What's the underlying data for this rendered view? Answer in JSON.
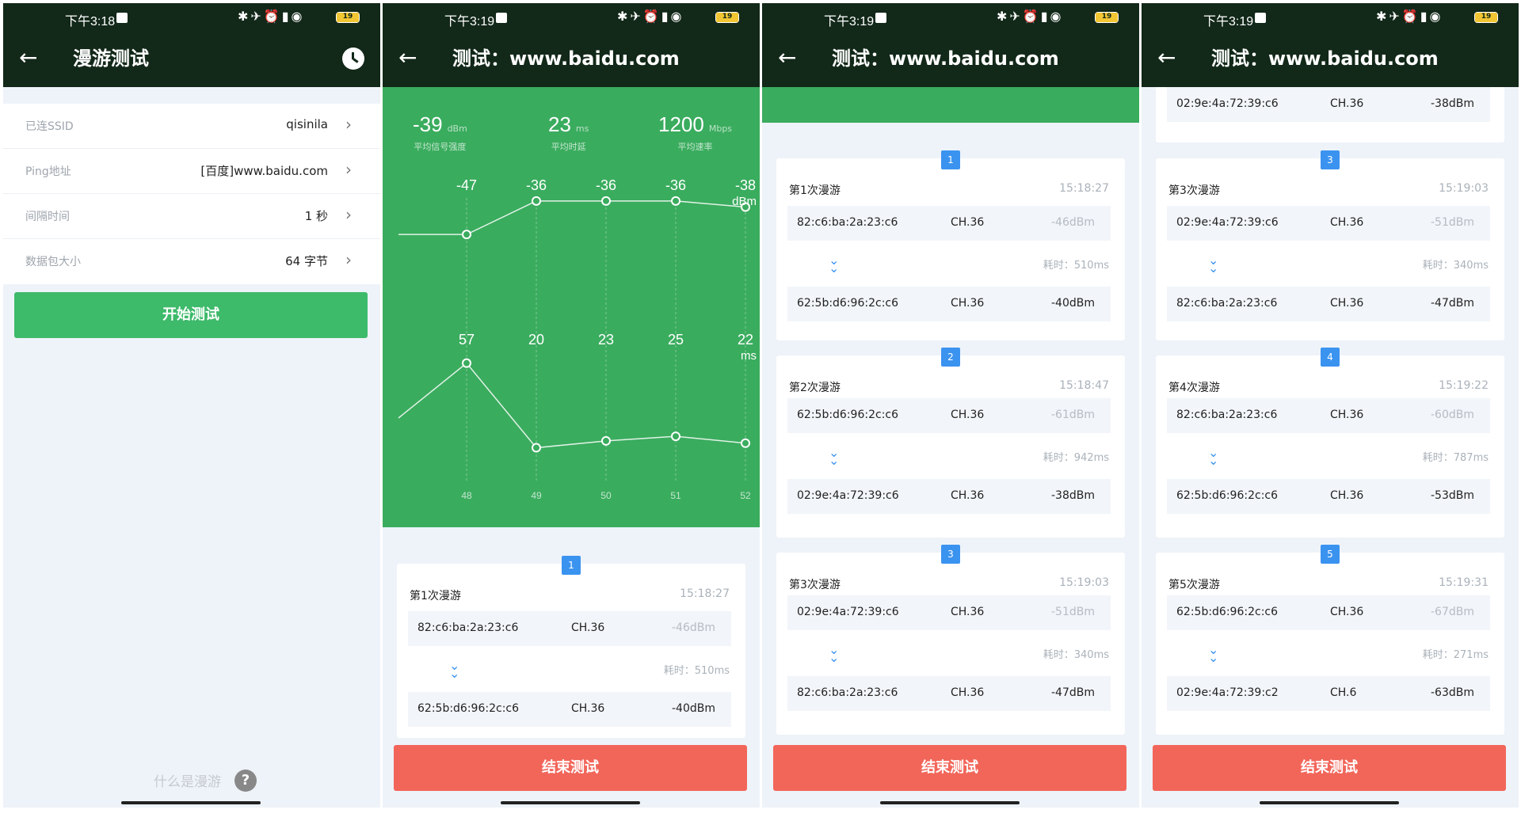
{
  "colors": {
    "appbar": "#122819",
    "green": "#3aac5e",
    "start_button": "#3dba6a",
    "end_button": "#f2665a",
    "badge": "#3b93f0"
  },
  "panel1": {
    "status_time": "下午3:18",
    "title": "漫游测试",
    "settings": [
      {
        "label": "已连SSID",
        "value": "qisinila"
      },
      {
        "label": "Ping地址",
        "value": "[百度]www.baidu.com"
      },
      {
        "label": "间隔时间",
        "value": "1 秒"
      },
      {
        "label": "数据包大小",
        "value": "64 字节"
      }
    ],
    "start_button": "开始测试",
    "help_text": "什么是漫游",
    "help_icon": "?"
  },
  "panel2": {
    "status_time": "下午3:19",
    "title": "测试：www.baidu.com",
    "stats": [
      {
        "value": "-39",
        "unit": "dBm",
        "label": "平均信号强度"
      },
      {
        "value": "23",
        "unit": "ms",
        "label": "平均时延"
      },
      {
        "value": "1200",
        "unit": "Mbps",
        "label": "平均速率"
      }
    ],
    "roams": [
      {
        "badge": "1",
        "title": "第1次漫游",
        "time": "15:18:27",
        "from": {
          "mac": "82:c6:ba:2a:23:c6",
          "ch": "CH.36",
          "dbm": "-46dBm"
        },
        "cost": "耗时：510ms",
        "to": {
          "mac": "62:5b:d6:96:2c:c6",
          "ch": "CH.36",
          "dbm": "-40dBm"
        }
      }
    ],
    "end_button": "结束测试"
  },
  "chart_data": [
    {
      "type": "line",
      "x": [
        47,
        48,
        49,
        50,
        51,
        52
      ],
      "x_tick_labels": [
        "48",
        "49",
        "50",
        "51",
        "52"
      ],
      "y": [
        -47,
        -47,
        -36,
        -36,
        -36,
        -38
      ],
      "data_labels": [
        "-47",
        "-36",
        "-36",
        "-36",
        "-38"
      ],
      "unit_label": "dBm"
    },
    {
      "type": "line",
      "x": [
        47,
        48,
        49,
        50,
        51,
        52
      ],
      "y": [
        33,
        57,
        20,
        23,
        25,
        22
      ],
      "data_labels": [
        "57",
        "20",
        "23",
        "25",
        "22"
      ],
      "unit_label": "ms"
    }
  ],
  "panel3": {
    "status_time": "下午3:19",
    "title": "测试：www.baidu.com",
    "roams": [
      {
        "badge": "1",
        "title": "第1次漫游",
        "time": "15:18:27",
        "from": {
          "mac": "82:c6:ba:2a:23:c6",
          "ch": "CH.36",
          "dbm": "-46dBm"
        },
        "cost": "耗时：510ms",
        "to": {
          "mac": "62:5b:d6:96:2c:c6",
          "ch": "CH.36",
          "dbm": "-40dBm"
        }
      },
      {
        "badge": "2",
        "title": "第2次漫游",
        "time": "15:18:47",
        "from": {
          "mac": "62:5b:d6:96:2c:c6",
          "ch": "CH.36",
          "dbm": "-61dBm"
        },
        "cost": "耗时：942ms",
        "to": {
          "mac": "02:9e:4a:72:39:c6",
          "ch": "CH.36",
          "dbm": "-38dBm"
        }
      },
      {
        "badge": "3",
        "title": "第3次漫游",
        "time": "15:19:03",
        "from": {
          "mac": "02:9e:4a:72:39:c6",
          "ch": "CH.36",
          "dbm": "-51dBm"
        },
        "cost": "耗时：340ms",
        "to": {
          "mac": "82:c6:ba:2a:23:c6",
          "ch": "CH.36",
          "dbm": "-47dBm"
        }
      }
    ],
    "end_button": "结束测试"
  },
  "panel4": {
    "status_time": "下午3:19",
    "title": "测试：www.baidu.com",
    "top_row": {
      "mac": "02:9e:4a:72:39:c6",
      "ch": "CH.36",
      "dbm": "-38dBm"
    },
    "roams": [
      {
        "badge": "3",
        "title": "第3次漫游",
        "time": "15:19:03",
        "from": {
          "mac": "02:9e:4a:72:39:c6",
          "ch": "CH.36",
          "dbm": "-51dBm"
        },
        "cost": "耗时：340ms",
        "to": {
          "mac": "82:c6:ba:2a:23:c6",
          "ch": "CH.36",
          "dbm": "-47dBm"
        }
      },
      {
        "badge": "4",
        "title": "第4次漫游",
        "time": "15:19:22",
        "from": {
          "mac": "82:c6:ba:2a:23:c6",
          "ch": "CH.36",
          "dbm": "-60dBm"
        },
        "cost": "耗时：787ms",
        "to": {
          "mac": "62:5b:d6:96:2c:c6",
          "ch": "CH.36",
          "dbm": "-53dBm"
        }
      },
      {
        "badge": "5",
        "title": "第5次漫游",
        "time": "15:19:31",
        "from": {
          "mac": "62:5b:d6:96:2c:c6",
          "ch": "CH.36",
          "dbm": "-67dBm"
        },
        "cost": "耗时：271ms",
        "to": {
          "mac": "02:9e:4a:72:39:c2",
          "ch": "CH.6",
          "dbm": "-63dBm"
        }
      }
    ],
    "end_button": "结束测试"
  }
}
